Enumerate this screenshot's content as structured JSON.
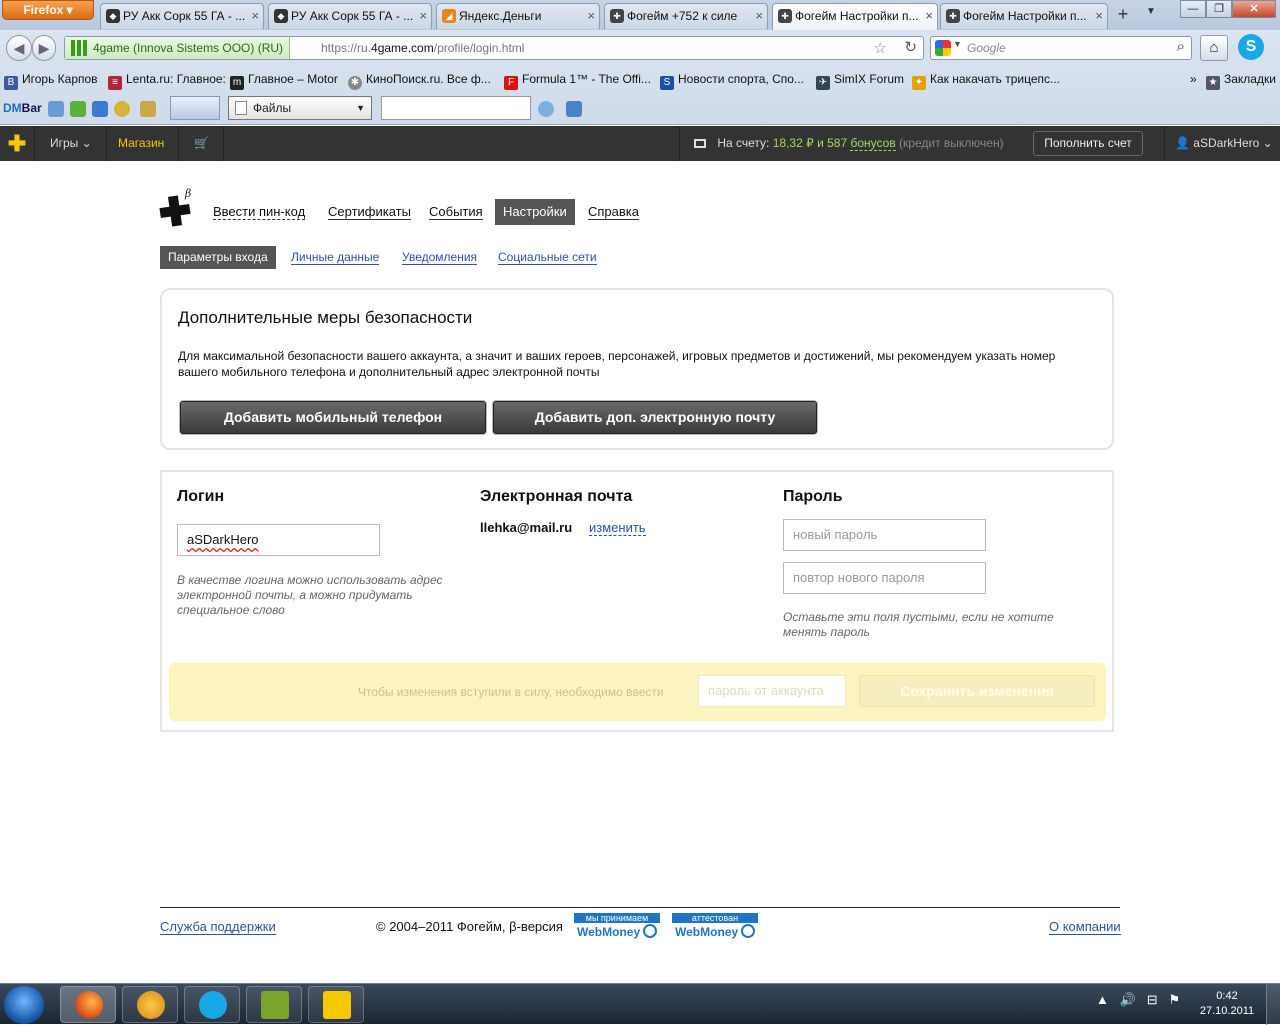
{
  "browser": {
    "menu_button": "Firefox",
    "tabs": [
      {
        "title": "РУ Акк Сорк 55 ГА - ..."
      },
      {
        "title": "РУ Акк Сорк 55 ГА - ..."
      },
      {
        "title": "Яндекс.Деньги"
      },
      {
        "title": "Фогейм +752 к силе"
      },
      {
        "title": "Фогейм Настройки п..."
      },
      {
        "title": "Фогейм Настройки п..."
      }
    ],
    "identity": "4game (Innova Sistems OOO) (RU)",
    "url_prefix": "https://ru.",
    "url_domain": "4game.com",
    "url_path": "/profile/login.html",
    "search_placeholder": "Google",
    "bookmarks": [
      "Игорь Карпов",
      "Lenta.ru: Главное:",
      "Главное – Motor",
      "КиноПоиск.ru. Все ф...",
      "Formula 1™ - The Offi...",
      "Новости спорта, Спо...",
      "SimIX Forum",
      "Как накачать трицепс..."
    ],
    "bookmarks_menu": "Закладки",
    "dmbar_label_a": "DM",
    "dmbar_label_b": "Bar",
    "files_select": "Файлы"
  },
  "sitebar": {
    "games": "Игры",
    "shop": "Магазин",
    "balance_label": "На счету:",
    "balance_amount": "18,32 ₽",
    "bonus_prefix": "и 587",
    "bonus_word": "бонусов",
    "credit": "(кредит выключен)",
    "topup": "Пополнить счет",
    "user": "aSDarkHero"
  },
  "nav": {
    "pin": "Ввести пин-код",
    "certs": "Сертификаты",
    "events": "События",
    "settings": "Настройки",
    "help": "Справка",
    "beta": "β"
  },
  "subnav": {
    "login_params": "Параметры входа",
    "personal": "Личные данные",
    "notifications": "Уведомления",
    "social": "Социальные сети"
  },
  "security": {
    "title": "Дополнительные меры безопасности",
    "text": "Для максимальной безопасности вашего аккаунта, а значит и ваших героев, персонажей, игровых предметов и достижений, мы рекомендуем указать номер вашего мобильного телефона и дополнительный адрес электронной почты",
    "add_phone": "Добавить мобильный телефон",
    "add_email": "Добавить доп. электронную почту"
  },
  "form": {
    "login_title": "Логин",
    "login_value": "aSDarkHero",
    "login_hint": "В качестве логина можно использовать адрес электронной почты, а можно придумать специальное слово",
    "email_title": "Электронная почта",
    "email_value": "llehka@mail.ru",
    "email_change": "изменить",
    "password_title": "Пароль",
    "new_password_placeholder": "новый пароль",
    "repeat_password_placeholder": "повтор нового пароля",
    "password_hint": "Оставьте эти поля пустыми, если не хотите менять пароль",
    "save_note": "Чтобы изменения вступили в силу, необходимо ввести",
    "account_password_placeholder": "пароль от аккаунта",
    "save_button": "Сохранить изменения"
  },
  "footer": {
    "support": "Служба поддержки",
    "copyright": "© 2004–2011 Фогейм, β-версия",
    "wm_accept_top": "мы принимаем",
    "wm_accept_brand": "WebMoney",
    "wm_attest_top": "аттестован",
    "wm_attest_brand": "WebMoney",
    "about": "О компании"
  },
  "taskbar": {
    "time": "0:42",
    "date": "27.10.2011"
  },
  "colors": {
    "accent": "#f5c800",
    "link": "#2b52a8",
    "balance": "#a5d65a",
    "save_bar": "#fbf4bf"
  }
}
